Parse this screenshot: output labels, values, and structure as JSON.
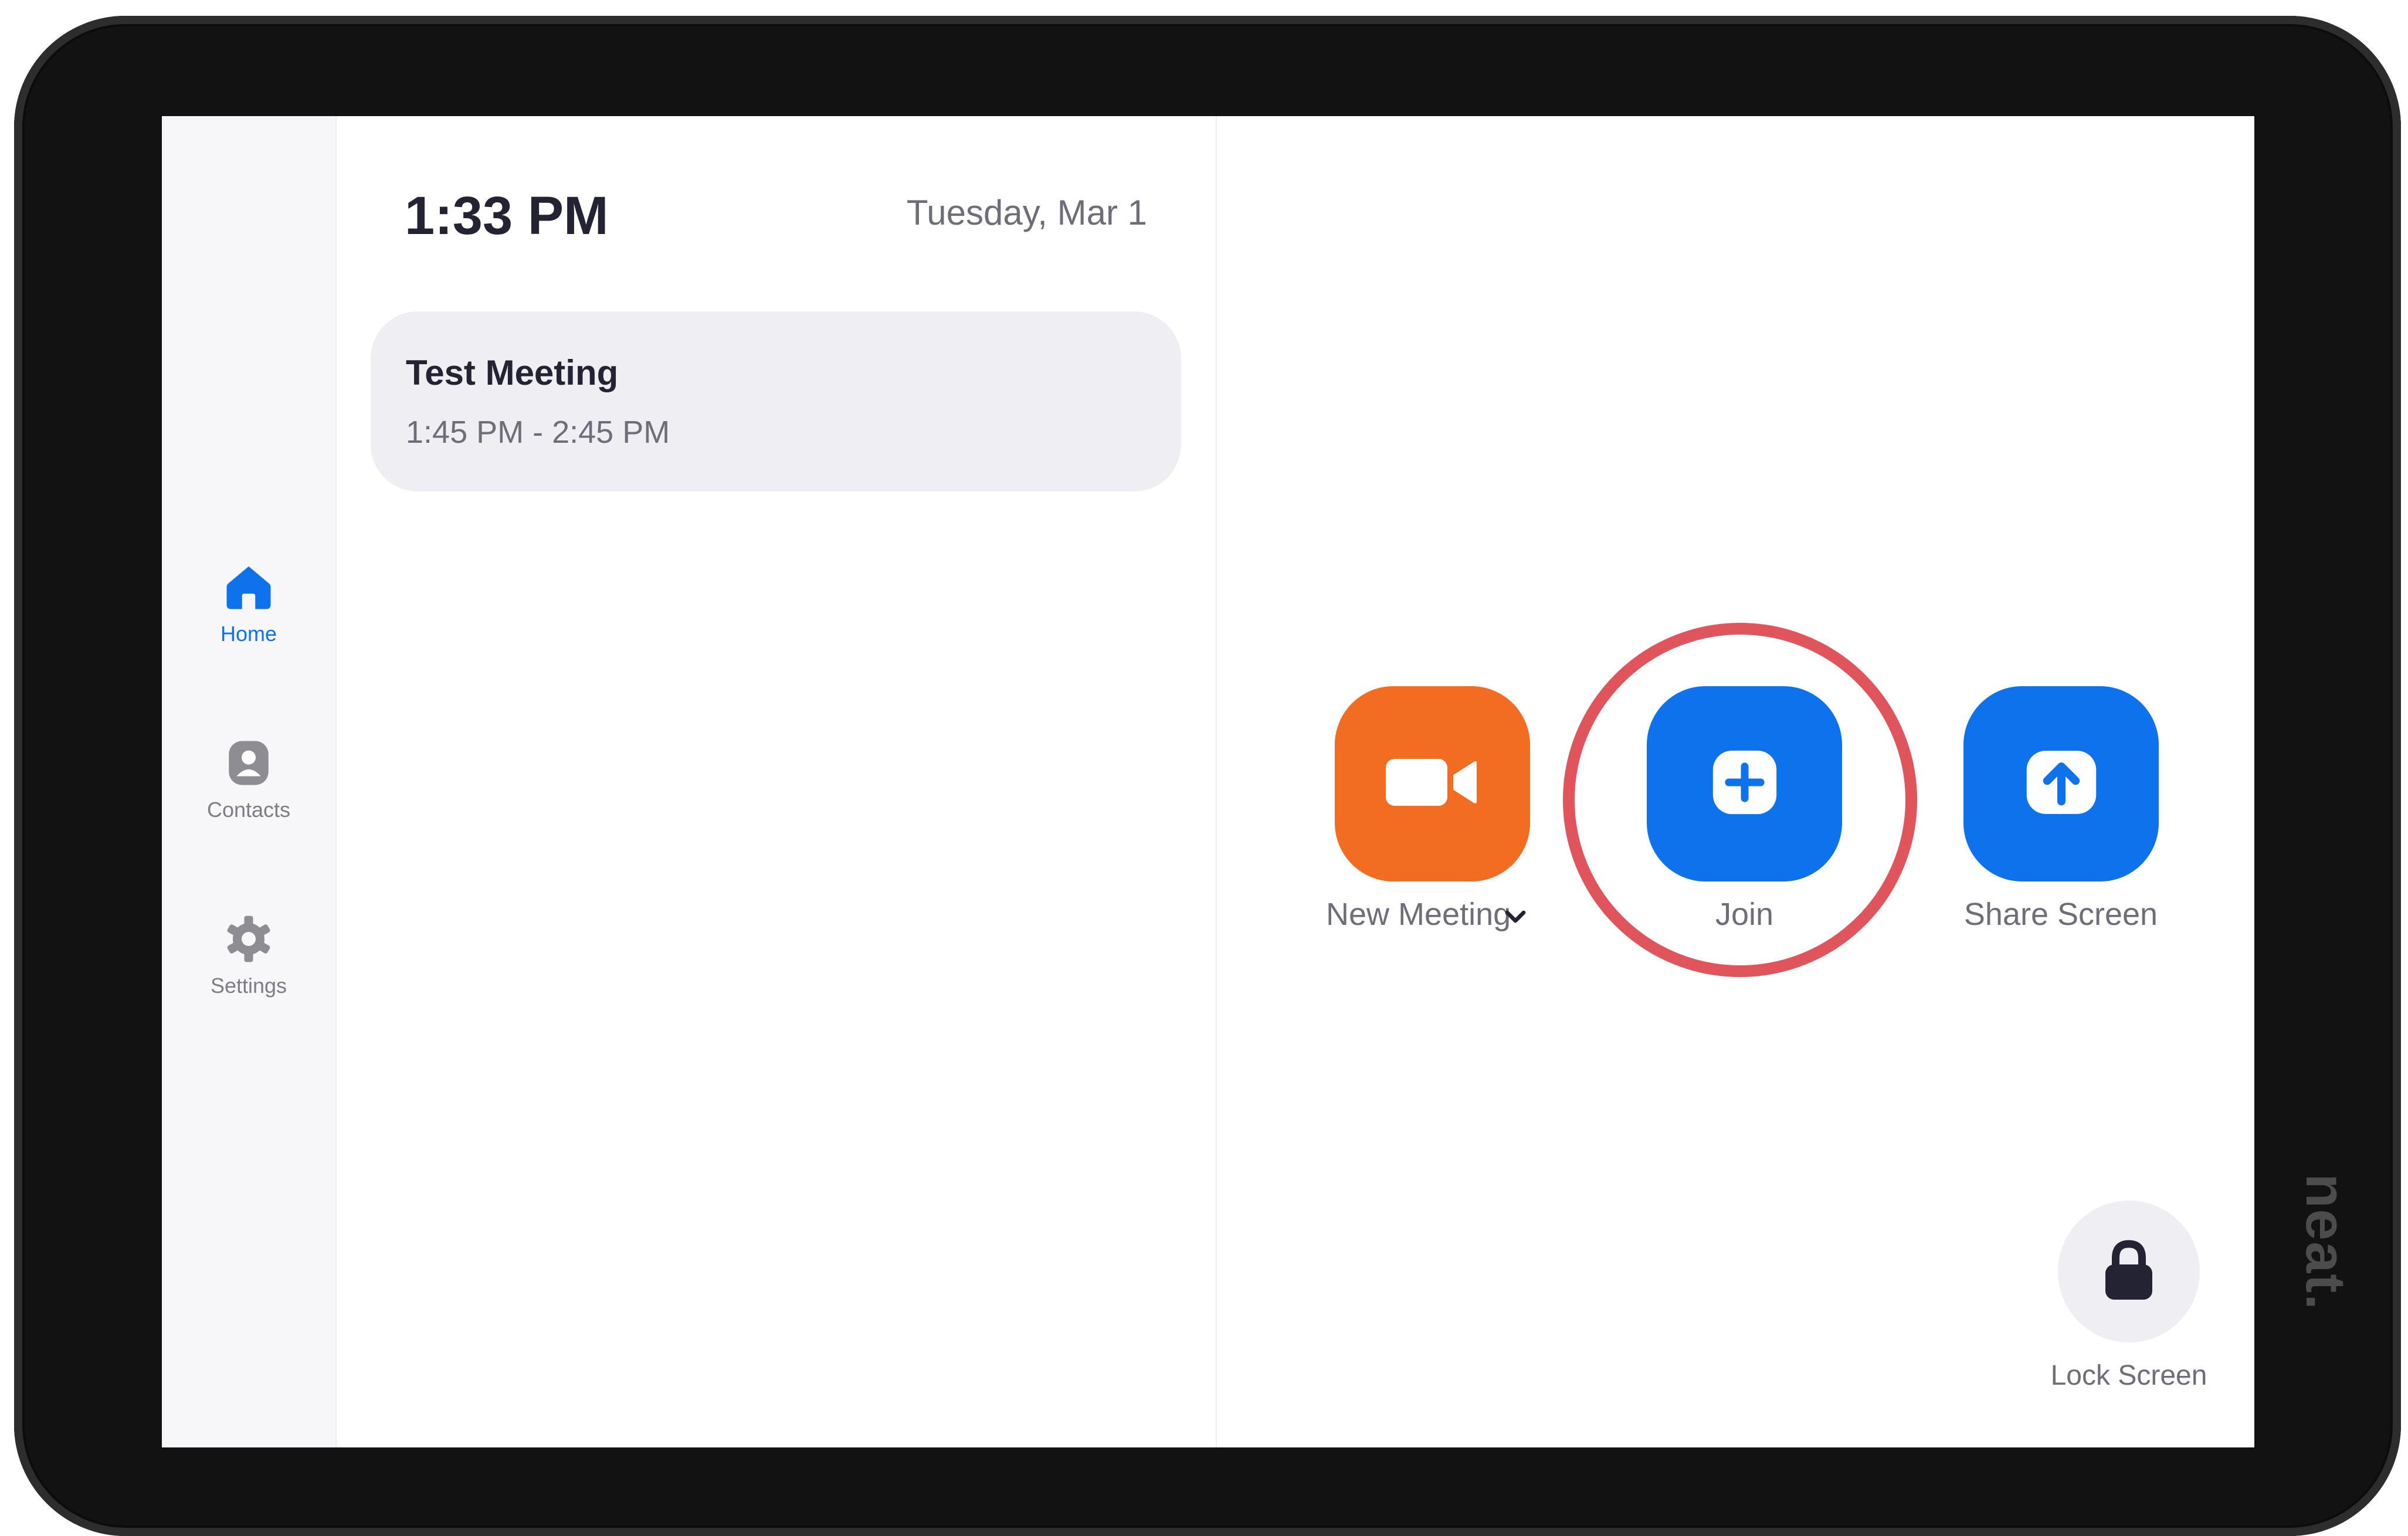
{
  "brand": "neat.",
  "sidebar": {
    "items": [
      {
        "label": "Home",
        "icon": "home-icon",
        "active": true
      },
      {
        "label": "Contacts",
        "icon": "contacts-icon",
        "active": false
      },
      {
        "label": "Settings",
        "icon": "settings-icon",
        "active": false
      }
    ]
  },
  "header": {
    "time": "1:33 PM",
    "date": "Tuesday, Mar 1"
  },
  "meetings": [
    {
      "title": "Test Meeting",
      "time": "1:45 PM - 2:45 PM"
    }
  ],
  "actions": {
    "new_meeting": {
      "label": "New Meeting",
      "icon": "video-camera-icon",
      "color": "#f26d21"
    },
    "join": {
      "label": "Join",
      "icon": "plus-icon",
      "color": "#0e72ed",
      "highlighted": true
    },
    "share_screen": {
      "label": "Share Screen",
      "icon": "arrow-up-icon",
      "color": "#0e72ed"
    },
    "lock_screen": {
      "label": "Lock Screen",
      "icon": "lock-icon"
    }
  },
  "colors": {
    "accent": "#0e72ed",
    "orange": "#f26d21",
    "highlight_ring": "#e0545c"
  }
}
